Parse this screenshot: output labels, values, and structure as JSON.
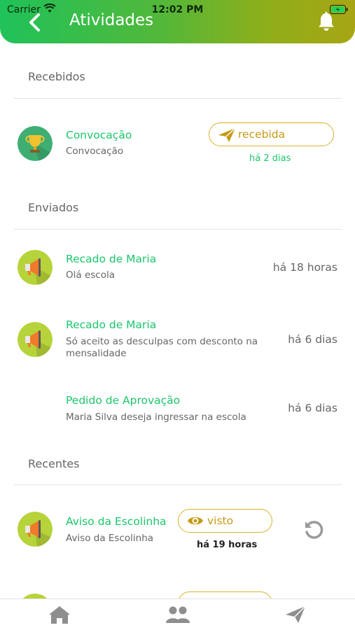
{
  "status_bar": {
    "carrier": "Carrier",
    "time": "12:02 PM"
  },
  "header": {
    "title": "Atividades",
    "back_icon": "chevron-left-icon",
    "bell_icon": "bell-icon"
  },
  "colors": {
    "header_start": "#1fc25a",
    "header_end": "#a8a514",
    "accent_green": "#1cc66b",
    "badge_gold": "#d9b12b"
  },
  "sections": {
    "recebidos": {
      "title": "Recebidos",
      "items": [
        {
          "title": "Convocação",
          "subtitle": "Convocação",
          "icon": "trophy-icon",
          "badge": "recebida",
          "badge_icon": "paper-plane-icon",
          "time": "há 2 dias"
        }
      ]
    },
    "enviados": {
      "title": "Enviados",
      "items": [
        {
          "title": "Recado de Maria",
          "subtitle": "Olá escola",
          "icon": "megaphone-icon",
          "time": "há 18 horas"
        },
        {
          "title": "Recado de Maria",
          "subtitle": "Só aceito as desculpas com desconto na mensalidade",
          "icon": "megaphone-icon",
          "time": "há 6 dias"
        },
        {
          "title": "Pedido de Aprovação",
          "subtitle": "Maria Silva deseja ingressar na escola",
          "time": "há 6 dias"
        }
      ]
    },
    "recentes": {
      "title": "Recentes",
      "items": [
        {
          "title": "Aviso da Escolinha",
          "subtitle": "Aviso da Escolinha",
          "icon": "megaphone-icon",
          "badge": "visto",
          "badge_icon": "eye-icon",
          "time": "há 19 horas",
          "action_icon": "refresh-icon"
        }
      ]
    }
  },
  "tabbar": {
    "tabs": [
      "home-icon",
      "users-icon",
      "paper-plane-icon"
    ]
  }
}
